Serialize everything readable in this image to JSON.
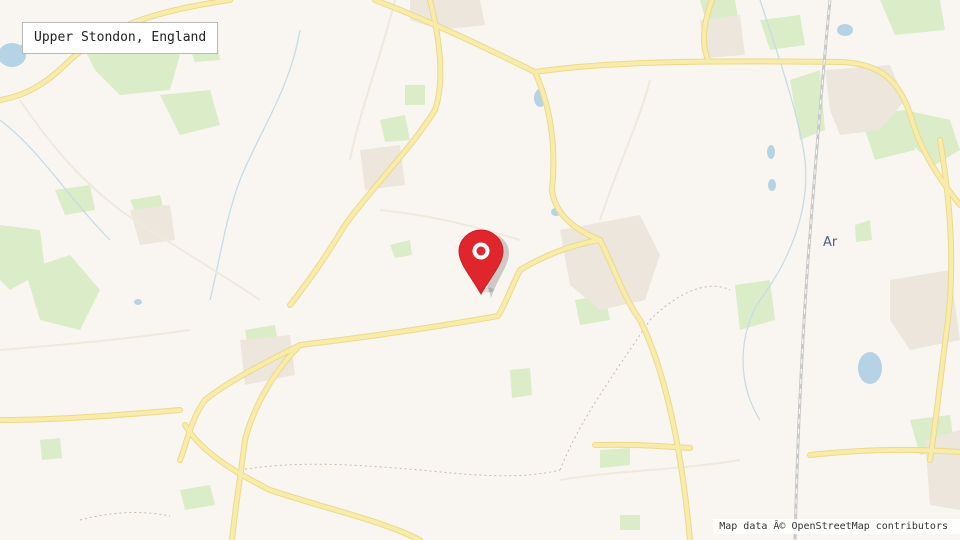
{
  "location": {
    "name": "Upper Stondon, England"
  },
  "map": {
    "town_label": "Ar",
    "marker_icon": "map-pin-icon",
    "marker_color": "#e0262d",
    "colors": {
      "background": "#f9f6f2",
      "road": "#f7ea9c",
      "road_edge": "#ecd98a",
      "woodland": "#dbecc8",
      "water": "#b6d3e6",
      "built_up": "#ece6dc",
      "railway": "#c9c9c9"
    }
  },
  "attribution": {
    "text": "Map data Â© OpenStreetMap contributors"
  }
}
